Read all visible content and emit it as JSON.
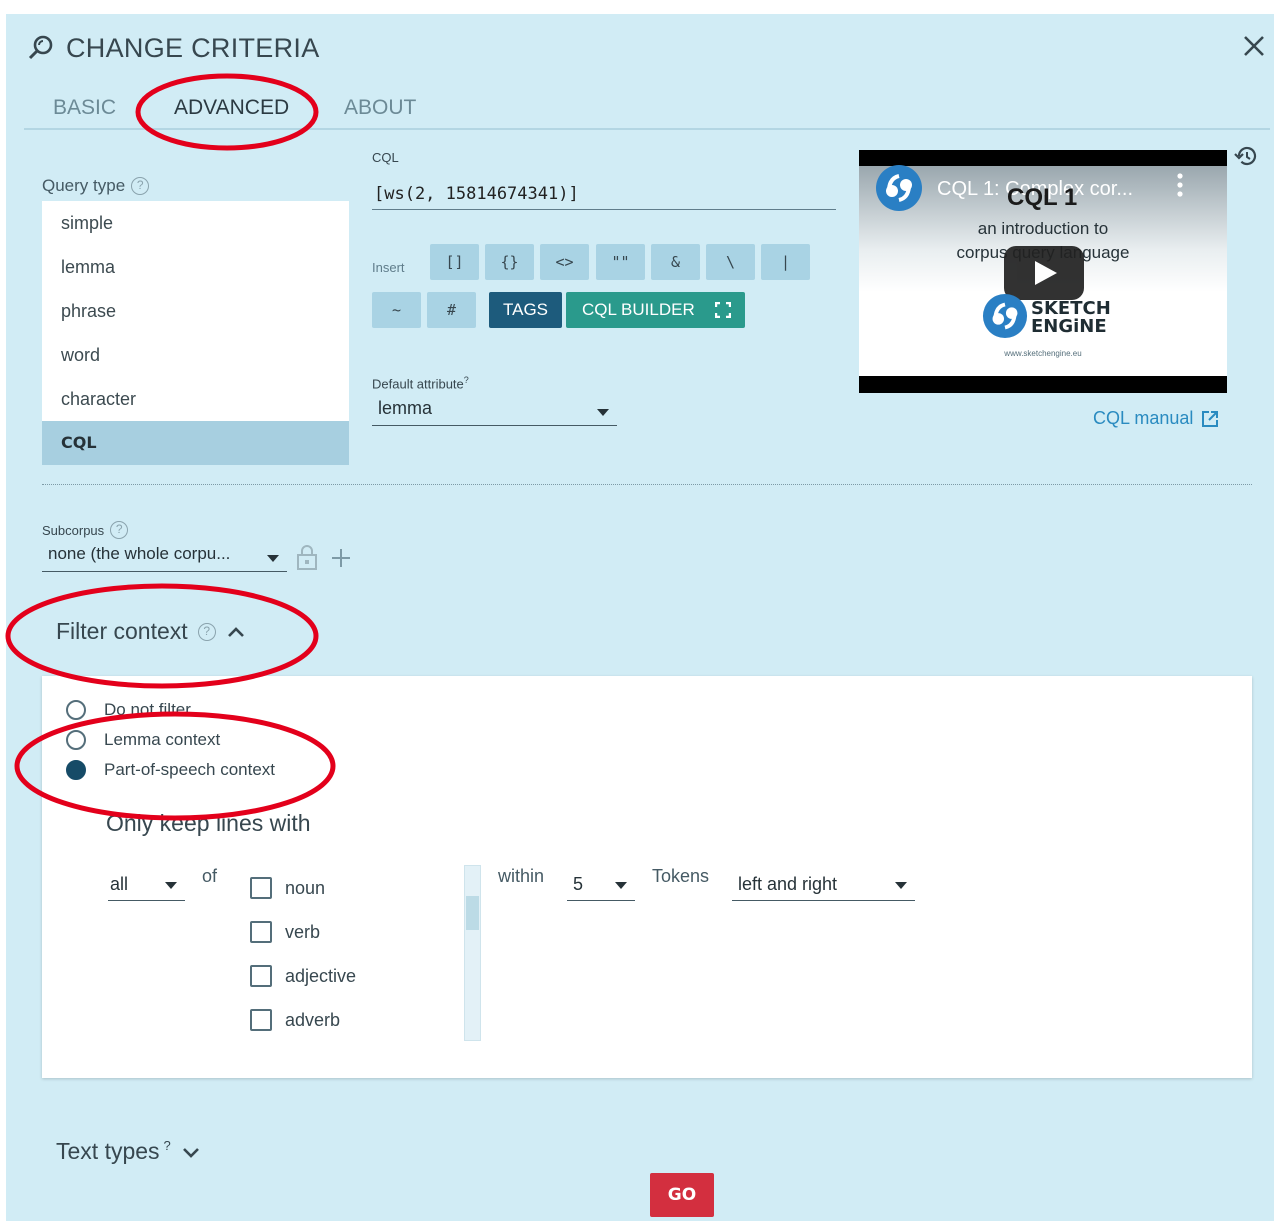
{
  "header": {
    "title": "CHANGE CRITERIA"
  },
  "tabs": [
    {
      "label": "BASIC",
      "active": false
    },
    {
      "label": "ADVANCED",
      "active": true
    },
    {
      "label": "ABOUT",
      "active": false
    }
  ],
  "query_type": {
    "label": "Query type",
    "options": [
      "simple",
      "lemma",
      "phrase",
      "word",
      "character",
      "CQL"
    ],
    "selected": "CQL"
  },
  "cql": {
    "label": "CQL",
    "value": "[ws(2, 15814674341)]",
    "insert_label": "Insert",
    "insert_buttons": [
      "[]",
      "{}",
      "<>",
      "\"\"",
      "&",
      "\\",
      "|",
      "~",
      "#"
    ],
    "tags_label": "TAGS",
    "builder_label": "CQL BUILDER"
  },
  "default_attribute": {
    "label": "Default attribute",
    "sup": "?",
    "value": "lemma"
  },
  "video": {
    "title": "CQL 1: Complex cor...",
    "overlay": "CQL 1",
    "line1": "an introduction to",
    "line2": "corpus query language",
    "brand1": "SKETCH",
    "brand2": "ENGiNE",
    "url": "www.sketchengine.eu"
  },
  "cql_manual": "CQL manual",
  "subcorpus": {
    "label": "Subcorpus",
    "value": "none (the whole corpu..."
  },
  "filter_context": {
    "title": "Filter context",
    "options": [
      "Do not filter",
      "Lemma context",
      "Part-of-speech context"
    ],
    "selected": "Part-of-speech context",
    "keep_label": "Only keep lines with",
    "quantifier": "all",
    "of_label": "of",
    "pos": [
      "noun",
      "verb",
      "adjective",
      "adverb"
    ],
    "within_label": "within",
    "within_value": "5",
    "tokens_label": "Tokens",
    "side": "left and right"
  },
  "text_types": {
    "label": "Text types",
    "sup": "?"
  },
  "go_label": "GO",
  "colors": {
    "panel": "#d1ecf5",
    "accent": "#2a9a8c",
    "tags": "#1d5b7c",
    "go": "#d32f3f",
    "annotation": "#e3001b"
  }
}
